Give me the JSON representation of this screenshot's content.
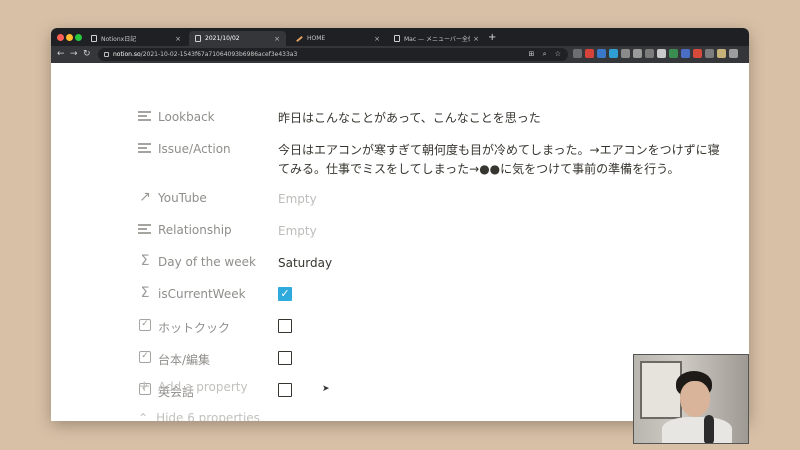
{
  "browser": {
    "tabs": [
      {
        "title": "Notionx日記",
        "active": false
      },
      {
        "title": "2021/10/02",
        "active": true
      },
      {
        "title": "HOME",
        "active": false
      },
      {
        "title": "Mac — メニューバー全体を隠すに",
        "active": false
      }
    ],
    "close_glyph": "×",
    "new_tab_glyph": "+",
    "url_host": "notion.so",
    "url_path": "/2021-10-02-1543f67a71064093b6986acef3e433a3",
    "nav": {
      "back": "←",
      "forward": "→",
      "reload": "↻"
    },
    "omnibox_icons": "⊞ ⌕ ☆"
  },
  "properties": [
    {
      "icon": "text-icon",
      "name": "Lookback",
      "type": "text",
      "value": "昨日はこんなことがあって、こんなことを思った"
    },
    {
      "icon": "text-icon",
      "name": "Issue/Action",
      "type": "text",
      "value": "今日はエアコンが寒すぎて朝何度も目が冷めてしまった。→エアコンをつけずに寝てみる。仕事でミスをしてしまった→●●に気をつけて事前の準備を行う。"
    },
    {
      "icon": "url-icon",
      "glyph": "↗",
      "name": "YouTube",
      "type": "url",
      "value": "Empty"
    },
    {
      "icon": "text-icon",
      "name": "Relationship",
      "type": "text",
      "value": "Empty"
    },
    {
      "icon": "formula-icon",
      "glyph": "Σ",
      "name": "Day of the week",
      "type": "formula",
      "value": "Saturday"
    },
    {
      "icon": "formula-icon",
      "glyph": "Σ",
      "name": "isCurrentWeek",
      "type": "formula-checkbox",
      "checked": true
    },
    {
      "icon": "checkbox-icon",
      "glyph": "✓",
      "name": "ホットクック",
      "type": "checkbox",
      "checked": false
    },
    {
      "icon": "checkbox-icon",
      "glyph": "✓",
      "name": "台本/編集",
      "type": "checkbox",
      "checked": false
    },
    {
      "icon": "checkbox-icon",
      "glyph": "✓",
      "name": "英会話",
      "type": "checkbox",
      "checked": false
    }
  ],
  "checkmark_glyph": "✓",
  "add_property": {
    "glyph": "+",
    "label": "Add a property"
  },
  "hide_properties": {
    "glyph": "⌃",
    "label": "Hide 6 properties"
  },
  "colors": {
    "checkbox_checked": "#2eaadc",
    "desktop": "#d8c0a6",
    "text": "#37352f",
    "muted": "#8f8e8b"
  }
}
